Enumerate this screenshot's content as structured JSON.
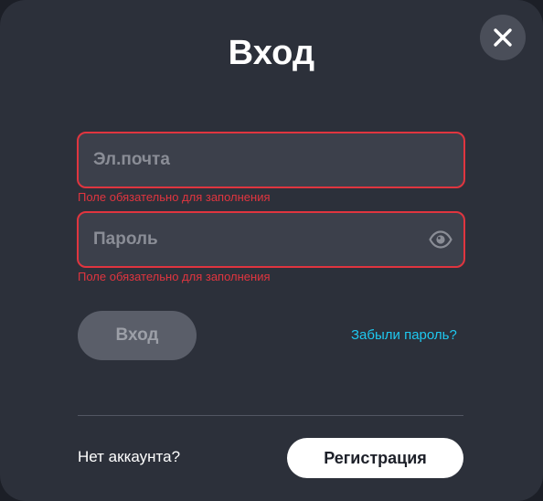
{
  "dialog": {
    "title": "Вход",
    "close_icon": "close-icon"
  },
  "form": {
    "email": {
      "placeholder": "Эл.почта",
      "value": "",
      "error": "Поле обязательно для заполнения"
    },
    "password": {
      "placeholder": "Пароль",
      "value": "",
      "error": "Поле обязательно для заполнения",
      "toggle_icon": "eye-icon"
    },
    "submit_label": "Вход",
    "forgot_label": "Забыли пароль?"
  },
  "footer": {
    "no_account_text": "Нет аккаунта?",
    "register_label": "Регистрация"
  },
  "colors": {
    "background": "#2c303a",
    "field_background": "#3c404b",
    "error": "#e0353f",
    "link": "#1ec8f0",
    "disabled_button": "#5a5e69"
  }
}
